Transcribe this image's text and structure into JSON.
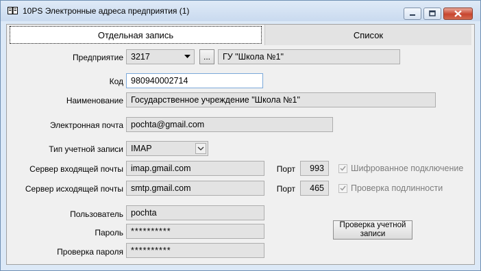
{
  "window": {
    "title": "10PS Электронные адреса предприятия (1)"
  },
  "tabs": [
    {
      "label": "Отдельная запись"
    },
    {
      "label": "Список"
    }
  ],
  "form": {
    "enterprise": {
      "label": "Предприятие",
      "code": "3217",
      "browse_label": "...",
      "name": "ГУ \"Школа №1\""
    },
    "code": {
      "label": "Код",
      "value": "980940002714"
    },
    "full_name": {
      "label": "Наименование",
      "value": "Государственное учреждение \"Школа №1\""
    },
    "email": {
      "label": "Электронная почта",
      "value": "pochta@gmail.com"
    },
    "account_type": {
      "label": "Тип учетной записи",
      "value": "IMAP"
    },
    "incoming": {
      "label": "Сервер входящей почты",
      "value": "imap.gmail.com",
      "port_label": "Порт",
      "port": "993",
      "option_label": "Шифрованное подключение",
      "checked": true
    },
    "outgoing": {
      "label": "Сервер исходящей почты",
      "value": "smtp.gmail.com",
      "port_label": "Порт",
      "port": "465",
      "option_label": "Проверка подлинности",
      "checked": true
    },
    "user": {
      "label": "Пользователь",
      "value": "pochta"
    },
    "password": {
      "label": "Пароль",
      "value": "**********"
    },
    "password_confirm": {
      "label": "Проверка пароля",
      "value": "**********"
    },
    "verify_button": {
      "label_line1": "Проверка учетной",
      "label_line2": "записи"
    }
  }
}
